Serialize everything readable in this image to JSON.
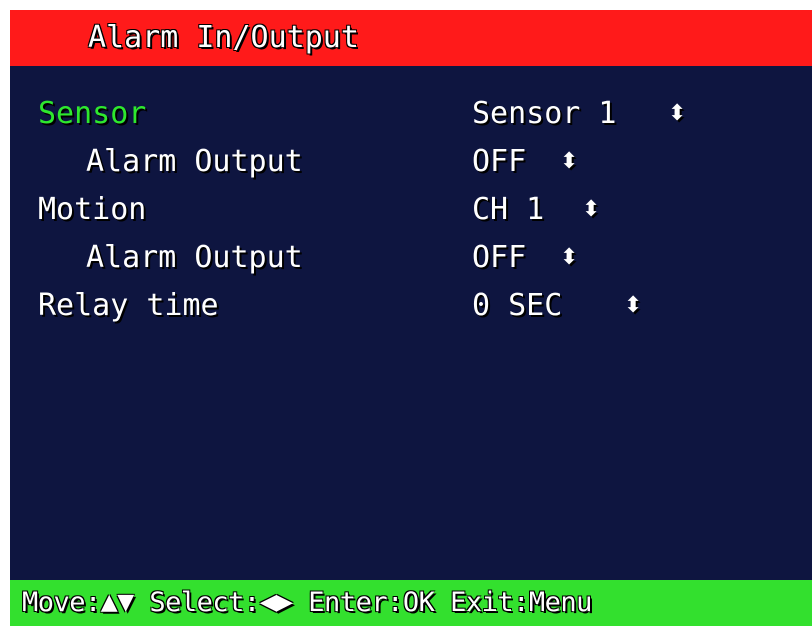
{
  "title": "Alarm In/Output",
  "menu": [
    {
      "label": "Sensor",
      "value": "Sensor 1",
      "selected": true
    },
    {
      "label": "Alarm Output",
      "value": "OFF",
      "selected": false
    },
    {
      "label": "Motion",
      "value": "CH 1",
      "selected": false
    },
    {
      "label": "Alarm Output",
      "value": "OFF",
      "selected": false
    },
    {
      "label": "Relay time",
      "value": "0 SEC",
      "selected": false
    }
  ],
  "status": {
    "move_label": "Move:",
    "move_icons": "▲▼",
    "select_label": "Select:",
    "select_icons": "◀▶",
    "enter": "Enter:OK",
    "exit": "Exit:Menu"
  },
  "colors": {
    "title_bar": "#ff1a1a",
    "background": "#0e1540",
    "selected_text": "#2ee82e",
    "status_bar": "#33e02e"
  }
}
